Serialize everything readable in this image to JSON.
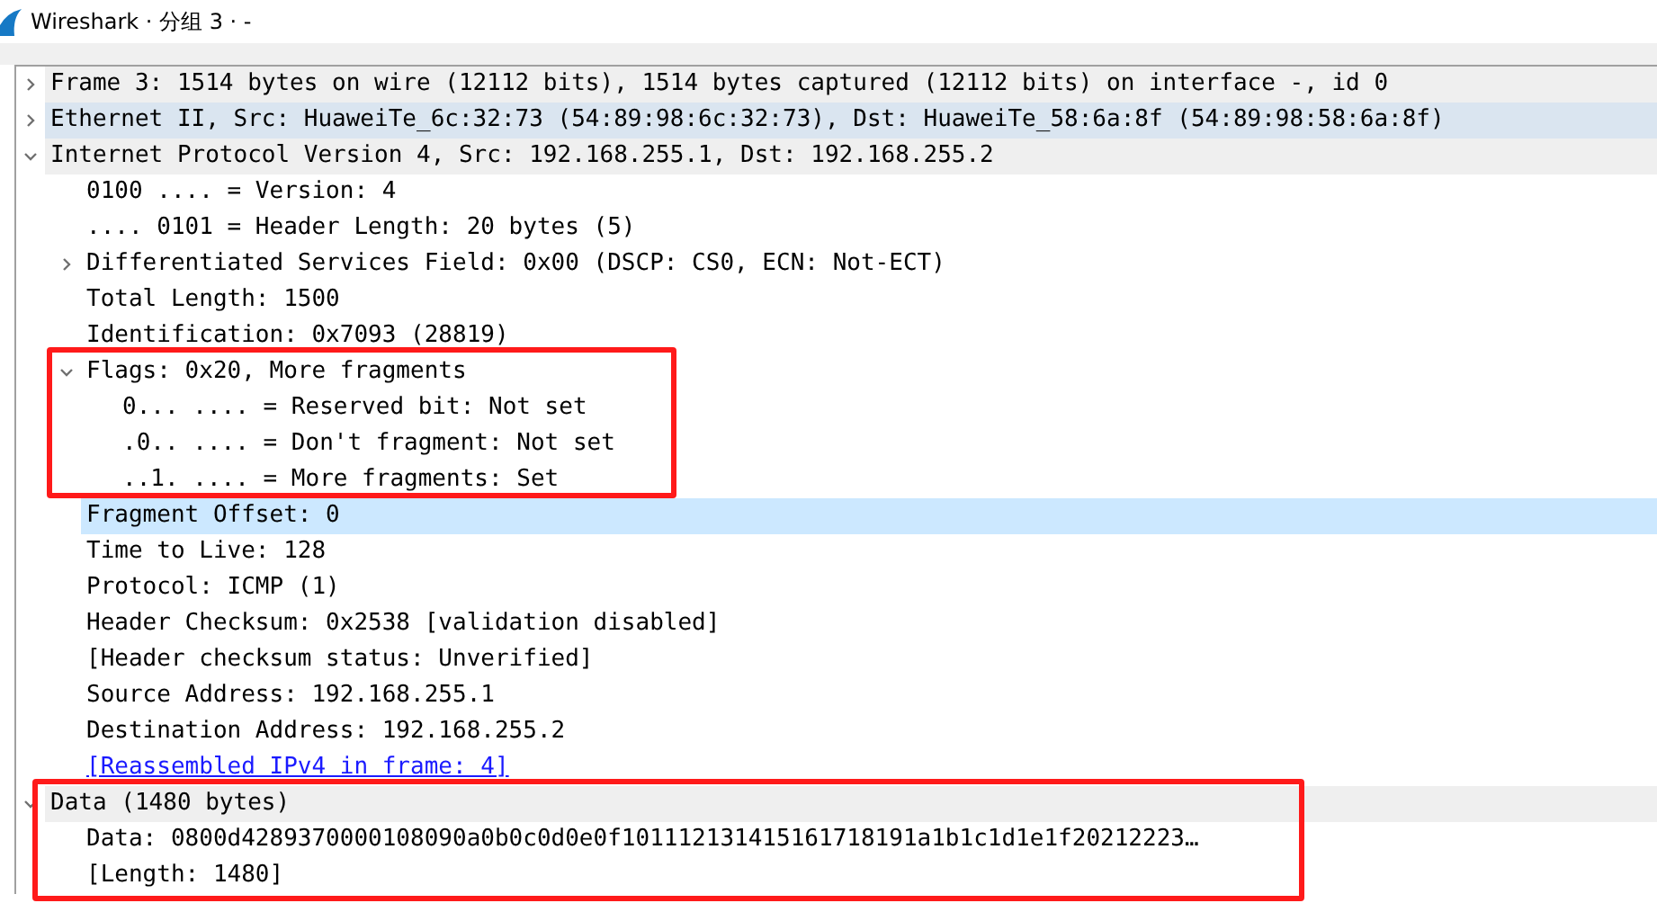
{
  "window": {
    "title": "Wireshark · 分组 3 · -"
  },
  "tree": [
    {
      "text": "Frame 3: 1514 bytes on wire (12112 bits), 1514 bytes captured (12112 bits) on interface -, id 0",
      "expanded": false,
      "selected": false,
      "hovered": false
    },
    {
      "text": "Ethernet II, Src: HuaweiTe_6c:32:73 (54:89:98:6c:32:73), Dst: HuaweiTe_58:6a:8f (54:89:98:58:6a:8f)",
      "expanded": false,
      "selected": false,
      "hovered": true
    },
    {
      "text": "Internet Protocol Version 4, Src: 192.168.255.1, Dst: 192.168.255.2",
      "expanded": true,
      "selected": false,
      "hovered": false,
      "children": [
        {
          "text": "0100 .... = Version: 4",
          "selected": false,
          "hovered": false
        },
        {
          "text": ".... 0101 = Header Length: 20 bytes (5)",
          "selected": false,
          "hovered": false
        },
        {
          "text": "Differentiated Services Field: 0x00 (DSCP: CS0, ECN: Not-ECT)",
          "expanded": false,
          "selected": false,
          "hovered": false
        },
        {
          "text": "Total Length: 1500",
          "selected": false,
          "hovered": false
        },
        {
          "text": "Identification: 0x7093 (28819)",
          "selected": false,
          "hovered": false
        },
        {
          "text": "Flags: 0x20, More fragments",
          "expanded": true,
          "selected": false,
          "hovered": false,
          "annotated": true,
          "children": [
            {
              "text": "0... .... = Reserved bit: Not set",
              "selected": false,
              "hovered": false
            },
            {
              "text": ".0.. .... = Don't fragment: Not set",
              "selected": false,
              "hovered": false
            },
            {
              "text": "..1. .... = More fragments: Set",
              "selected": false,
              "hovered": false
            }
          ]
        },
        {
          "text": "Fragment Offset: 0",
          "selected": true,
          "hovered": false
        },
        {
          "text": "Time to Live: 128",
          "selected": false,
          "hovered": false
        },
        {
          "text": "Protocol: ICMP (1)",
          "selected": false,
          "hovered": false
        },
        {
          "text": "Header Checksum: 0x2538 [validation disabled]",
          "selected": false,
          "hovered": false
        },
        {
          "text": "[Header checksum status: Unverified]",
          "selected": false,
          "hovered": false
        },
        {
          "text": "Source Address: 192.168.255.1",
          "selected": false,
          "hovered": false
        },
        {
          "text": "Destination Address: 192.168.255.2",
          "selected": false,
          "hovered": false
        },
        {
          "text": "[Reassembled IPv4 in frame: 4]",
          "selected": false,
          "hovered": false,
          "kind": "link"
        }
      ]
    },
    {
      "text": "Data (1480 bytes)",
      "expanded": true,
      "selected": false,
      "hovered": false,
      "annotated": true,
      "children": [
        {
          "text": "Data: 0800d4289370000108090a0b0c0d0e0f101112131415161718191a1b1c1d1e1f20212223…",
          "selected": false,
          "hovered": false
        },
        {
          "text": "[Length: 1480]",
          "selected": false,
          "hovered": false
        }
      ]
    }
  ]
}
